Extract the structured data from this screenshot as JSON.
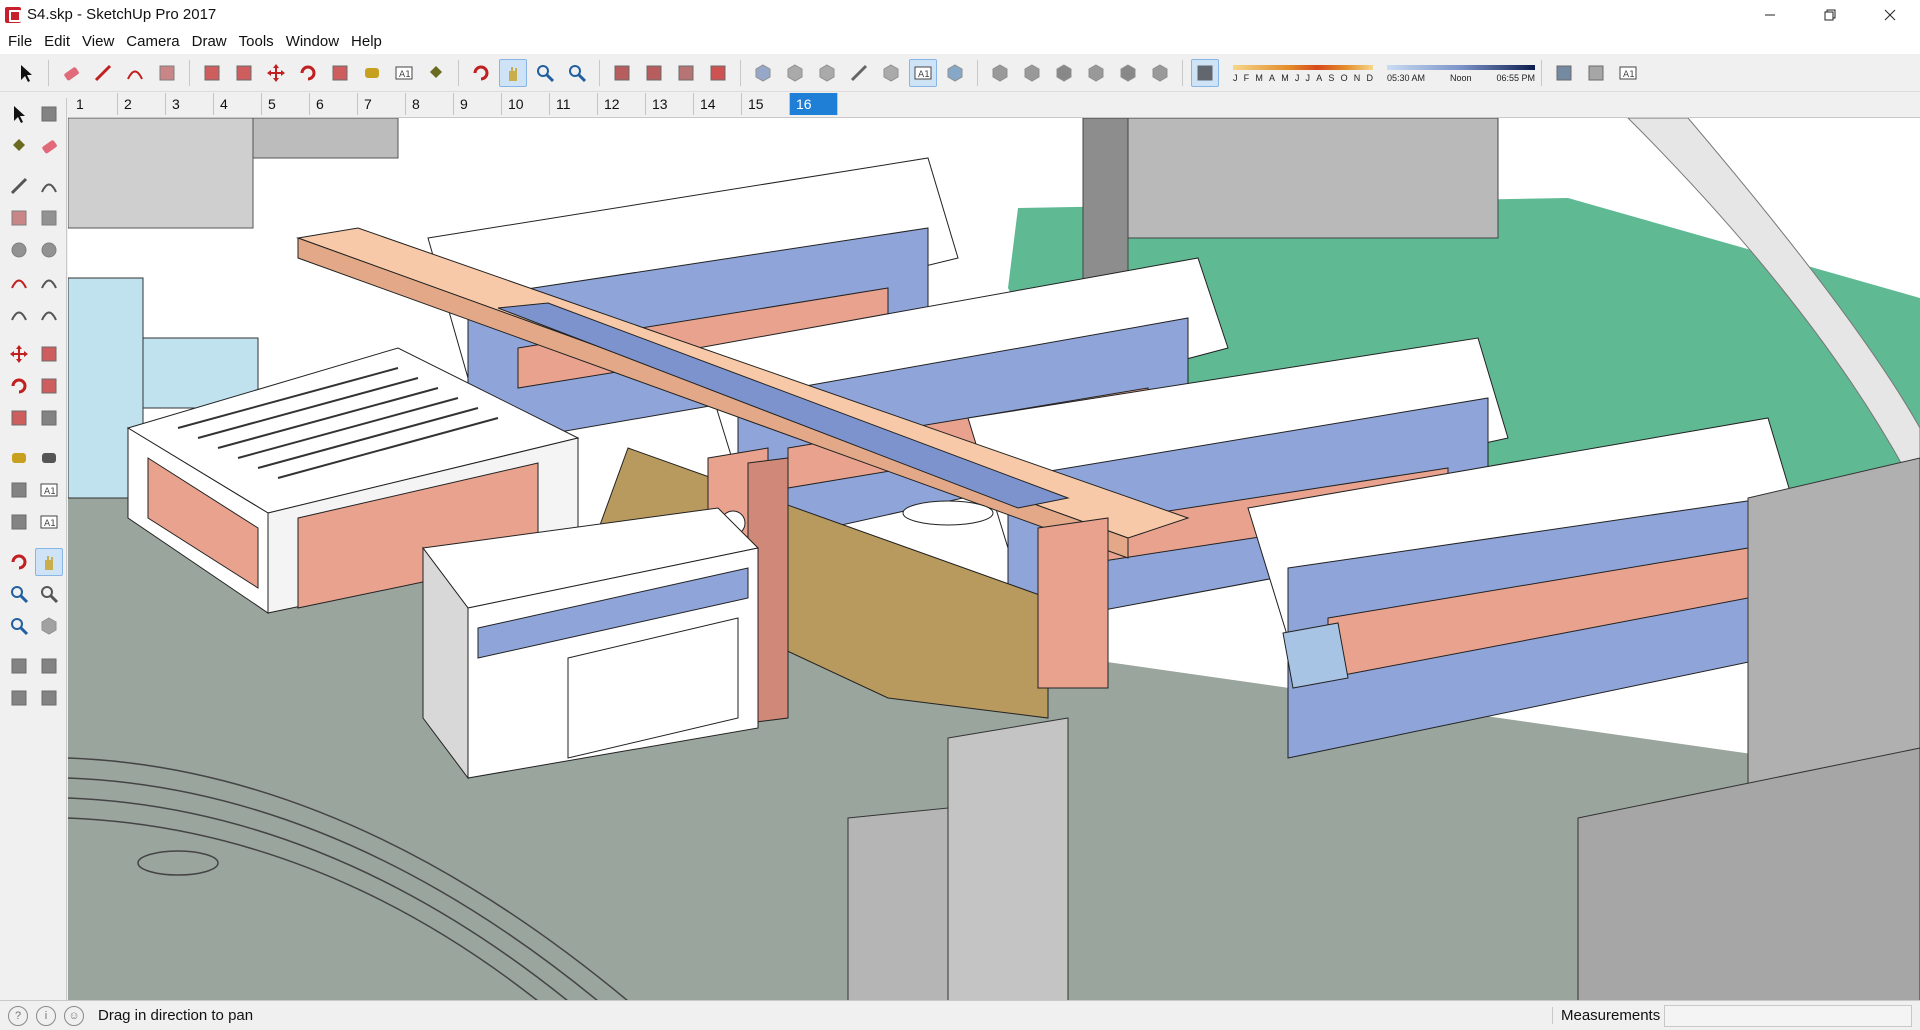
{
  "window": {
    "title": "S4.skp - SketchUp Pro 2017",
    "controls": [
      "minimize",
      "restore",
      "close"
    ]
  },
  "menu": [
    "File",
    "Edit",
    "View",
    "Camera",
    "Draw",
    "Tools",
    "Window",
    "Help"
  ],
  "toolbar": {
    "buttons": [
      {
        "icon": "select-arrow-icon"
      },
      {
        "icon": "eraser-icon"
      },
      {
        "icon": "pencil-icon"
      },
      {
        "icon": "arc-icon"
      },
      {
        "icon": "rectangle-icon"
      },
      {
        "icon": "push-pull-icon"
      },
      {
        "icon": "follow-me-icon"
      },
      {
        "icon": "move-icon"
      },
      {
        "icon": "rotate-icon"
      },
      {
        "icon": "scale-icon"
      },
      {
        "icon": "tape-measure-icon"
      },
      {
        "icon": "text-icon"
      },
      {
        "icon": "paint-bucket-icon"
      },
      {
        "icon": "orbit-icon"
      },
      {
        "icon": "pan-icon",
        "active": true
      },
      {
        "icon": "zoom-icon"
      },
      {
        "icon": "zoom-extents-icon"
      },
      {
        "icon": "3d-warehouse-icon"
      },
      {
        "icon": "extension-warehouse-icon"
      },
      {
        "icon": "layout-icon"
      },
      {
        "icon": "ruby-gem-icon"
      },
      {
        "icon": "xray-icon"
      },
      {
        "icon": "back-edges-icon"
      },
      {
        "icon": "wireframe-icon"
      },
      {
        "icon": "hidden-line-icon"
      },
      {
        "icon": "shaded-icon"
      },
      {
        "icon": "shaded-textures-icon",
        "active": true
      },
      {
        "icon": "monochrome-icon"
      },
      {
        "icon": "iso-view-icon"
      },
      {
        "icon": "top-view-icon"
      },
      {
        "icon": "front-view-icon"
      },
      {
        "icon": "right-view-icon"
      },
      {
        "icon": "back-view-icon"
      },
      {
        "icon": "left-view-icon"
      },
      {
        "icon": "shadows-toggle-icon",
        "active": true
      }
    ],
    "months": [
      "J",
      "F",
      "M",
      "A",
      "M",
      "J",
      "J",
      "A",
      "S",
      "O",
      "N",
      "D"
    ],
    "time_start": "05:30 AM",
    "time_mid": "Noon",
    "time_end": "06:55 PM",
    "extra_buttons": [
      {
        "icon": "add-location-icon"
      },
      {
        "icon": "toggle-terrain-icon"
      },
      {
        "icon": "photo-textures-icon"
      }
    ]
  },
  "scenes": {
    "tabs": [
      "1",
      "2",
      "3",
      "4",
      "5",
      "6",
      "7",
      "8",
      "9",
      "10",
      "11",
      "12",
      "13",
      "14",
      "15",
      "16"
    ],
    "active": "16"
  },
  "left_tools": [
    [
      "select-arrow-icon",
      "component-icon"
    ],
    [
      "paint-bucket-icon",
      "eraser-icon"
    ],
    [
      "line-icon",
      "freehand-icon"
    ],
    [
      "rectangle-icon",
      "rotated-rectangle-icon"
    ],
    [
      "circle-icon",
      "polygon-icon"
    ],
    [
      "arc-icon",
      "two-point-arc-icon"
    ],
    [
      "pie-icon",
      "three-point-arc-icon"
    ],
    [
      "move-icon",
      "push-pull-icon"
    ],
    [
      "rotate-icon",
      "follow-me-icon"
    ],
    [
      "scale-icon",
      "offset-icon"
    ],
    [
      "tape-measure-icon",
      "dimension-icon"
    ],
    [
      "protractor-icon",
      "text-icon"
    ],
    [
      "axes-icon",
      "3d-text-icon"
    ],
    [
      "orbit-icon",
      "pan-icon"
    ],
    [
      "zoom-icon",
      "zoom-window-icon"
    ],
    [
      "zoom-extents-icon",
      "previous-view-icon"
    ],
    [
      "position-camera-icon",
      "look-around-icon"
    ],
    [
      "walk-icon",
      "section-plane-icon"
    ]
  ],
  "status": {
    "message": "Drag in direction to pan",
    "measurements_label": "Measurements",
    "measurements_value": ""
  }
}
